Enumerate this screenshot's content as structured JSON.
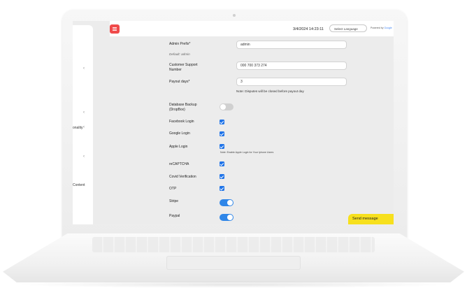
{
  "header": {
    "datetime": "3/4/2024 14:23:11",
    "language_select": "Select Language",
    "powered_by_prefix": "Powered by",
    "powered_by_brand": "Google"
  },
  "sidebar": {
    "partial_labels": [
      "onality",
      "Content"
    ]
  },
  "form": {
    "admin_prefix_label": "Admin Prefix*",
    "admin_prefix_value": "admin",
    "admin_prefix_hint": "Default: admin",
    "support_label_line1": "Customer Support",
    "support_label_line2": "Number",
    "support_value": "000 700 373 274",
    "payout_label": "Payout days*",
    "payout_value": "3",
    "payout_note": "Note: Disputes will be closed before payout day",
    "backup_label_line1": "Database Backup",
    "backup_label_line2": "(DropBox)",
    "backup_enabled": false,
    "facebook_label": "Facebook Login",
    "facebook_checked": true,
    "google_label": "Google Login",
    "google_checked": true,
    "apple_label": "Apple Login",
    "apple_checked": true,
    "apple_note": "Note: Enable Apple Login for Your Iphone Users",
    "recaptcha_label": "reCAPTCHA",
    "recaptcha_checked": true,
    "covid_label": "Covid Verification",
    "covid_checked": true,
    "otp_label": "OTP",
    "otp_checked": true,
    "stripe_label": "Stripe",
    "stripe_enabled": true,
    "paypal_label": "Paypal",
    "paypal_enabled": true
  },
  "chat": {
    "send_message_label": "Send message"
  },
  "colors": {
    "menu_button": "#f04a4a",
    "accent_blue": "#1e73e8",
    "send_button": "#f7e01d"
  }
}
